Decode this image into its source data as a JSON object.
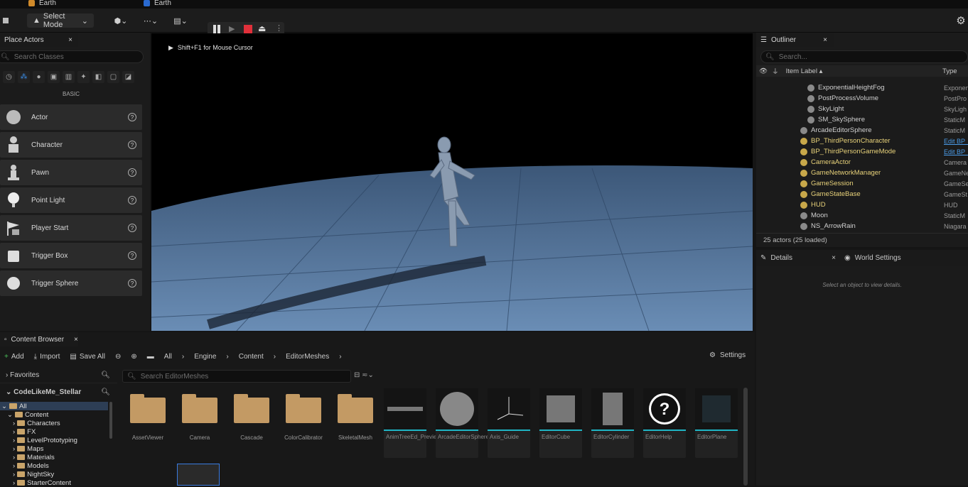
{
  "tabs": [
    {
      "label": "Earth"
    },
    {
      "label": "Earth"
    }
  ],
  "toolbar": {
    "select_mode": "Select Mode"
  },
  "place_actors": {
    "title": "Place Actors",
    "search_placeholder": "Search Classes",
    "category": "BASIC",
    "items": [
      {
        "label": "Actor",
        "icon": "sphere-icon"
      },
      {
        "label": "Character",
        "icon": "character-icon"
      },
      {
        "label": "Pawn",
        "icon": "pawn-icon"
      },
      {
        "label": "Point Light",
        "icon": "bulb-icon"
      },
      {
        "label": "Player Start",
        "icon": "flag-icon"
      },
      {
        "label": "Trigger Box",
        "icon": "cube-icon"
      },
      {
        "label": "Trigger Sphere",
        "icon": "sphere-icon"
      }
    ]
  },
  "viewport": {
    "hint": "Shift+F1 for Mouse Cursor"
  },
  "outliner": {
    "title": "Outliner",
    "search_placeholder": "Search...",
    "col_label": "Item Label ▴",
    "col_type": "Type",
    "rows": [
      {
        "label": "ExponentialHeightFog",
        "type": "Exponen",
        "indent": 2,
        "color": "#d0d0d0"
      },
      {
        "label": "PostProcessVolume",
        "type": "PostPro",
        "indent": 2,
        "color": "#d0d0d0"
      },
      {
        "label": "SkyLight",
        "type": "SkyLigh",
        "indent": 2,
        "color": "#d0d0d0"
      },
      {
        "label": "SM_SkySphere",
        "type": "StaticM",
        "indent": 2,
        "color": "#d0d0d0"
      },
      {
        "label": "ArcadeEditorSphere",
        "type": "StaticM",
        "indent": 1,
        "color": "#d0d0d0"
      },
      {
        "label": "BP_ThirdPersonCharacter",
        "type": "Edit BP_",
        "indent": 1,
        "color": "#e8d27a"
      },
      {
        "label": "BP_ThirdPersonGameMode",
        "type": "Edit BP_",
        "indent": 1,
        "color": "#e8d27a"
      },
      {
        "label": "CameraActor",
        "type": "Camera",
        "indent": 1,
        "color": "#e8d27a"
      },
      {
        "label": "GameNetworkManager",
        "type": "GameNe",
        "indent": 1,
        "color": "#e8d27a"
      },
      {
        "label": "GameSession",
        "type": "GameSe",
        "indent": 1,
        "color": "#e8d27a"
      },
      {
        "label": "GameStateBase",
        "type": "GameSt",
        "indent": 1,
        "color": "#e8d27a"
      },
      {
        "label": "HUD",
        "type": "HUD",
        "indent": 1,
        "color": "#e8d27a"
      },
      {
        "label": "Moon",
        "type": "StaticM",
        "indent": 1,
        "color": "#d0d0d0"
      },
      {
        "label": "NS_ArrowRain",
        "type": "Niagara",
        "indent": 1,
        "color": "#d0d0d0"
      }
    ],
    "count": "25 actors (25 loaded)"
  },
  "details": {
    "tab": "Details",
    "world_tab": "World Settings",
    "empty": "Select an object to view details."
  },
  "content_browser": {
    "title": "Content Browser",
    "add": "Add",
    "import": "Import",
    "save_all": "Save All",
    "path": [
      "All",
      "Engine",
      "Content",
      "EditorMeshes"
    ],
    "settings": "Settings",
    "favorites": "Favorites",
    "project": "CodeLikeMe_Stellar",
    "search_placeholder": "Search EditorMeshes",
    "tree": [
      {
        "label": "All",
        "indent": 0
      },
      {
        "label": "Content",
        "indent": 1
      },
      {
        "label": "Characters",
        "indent": 2
      },
      {
        "label": "FX",
        "indent": 2
      },
      {
        "label": "LevelPrototyping",
        "indent": 2
      },
      {
        "label": "Maps",
        "indent": 2
      },
      {
        "label": "Materials",
        "indent": 2
      },
      {
        "label": "Models",
        "indent": 2
      },
      {
        "label": "NightSky",
        "indent": 2
      },
      {
        "label": "StarterContent",
        "indent": 2
      }
    ],
    "folders": [
      "AssetViewer",
      "Camera",
      "Cascade",
      "ColorCalibrator",
      "SkeletalMesh"
    ],
    "assets": [
      "AnimTreeEd_PreviewFloor",
      "ArcadeEditorSphere",
      "Axis_Guide",
      "EditorCube",
      "EditorCylinder",
      "EditorHelp",
      "EditorPlane"
    ]
  }
}
